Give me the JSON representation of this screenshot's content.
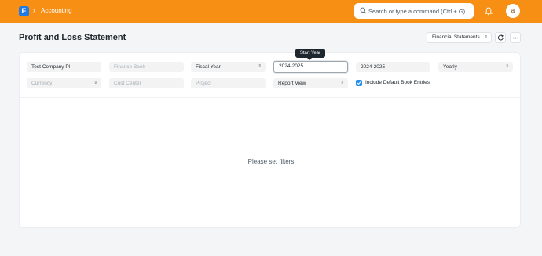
{
  "navbar": {
    "logo_letter": "E",
    "breadcrumb": "Accounting",
    "search_placeholder": "Search or type a command (Ctrl + G)",
    "avatar_initial": "a",
    "color": "#f78f14"
  },
  "page": {
    "title": "Profit and Loss Statement",
    "financial_statements_label": "Financial Statements"
  },
  "filters": {
    "company": "Test Company Pl",
    "finance_book": "Finance Book",
    "period_type": "Fiscal Year",
    "start_year": "2024-2025",
    "start_year_tooltip": "Start Year",
    "end_year": "2024-2025",
    "periodicity": "Yearly",
    "currency": "Currency",
    "cost_center": "Cost Center",
    "project": "Project",
    "report_view": "Report View",
    "include_default_book_entries": "Include Default Book Entries",
    "include_default_book_entries_checked": true
  },
  "report": {
    "empty_message": "Please set filters"
  },
  "icons": {
    "logo": "app-logo-icon",
    "breadcrumb_separator": "chevron-right-icon",
    "search": "search-icon",
    "notifications": "bell-icon",
    "refresh": "refresh-icon",
    "more": "more-horizontal-icon"
  }
}
